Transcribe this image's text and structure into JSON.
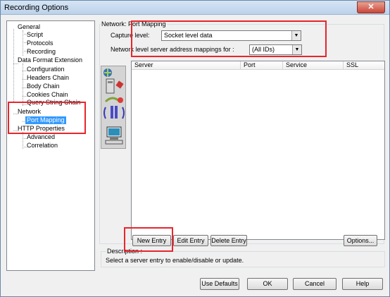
{
  "window": {
    "title": "Recording Options",
    "close_label": "✕"
  },
  "tree": {
    "items": [
      "General",
      "Script",
      "Protocols",
      "Recording",
      "Data Format Extension",
      "Configuration",
      "Headers Chain",
      "Body Chain",
      "Cookies Chain",
      "Query String Chain",
      "Network",
      "Port Mapping",
      "HTTP Properties",
      "Advanced",
      "Correlation"
    ],
    "selected": "Port Mapping"
  },
  "network": {
    "group_title": "Network: Port Mapping",
    "capture_level_label": "Capture level:",
    "capture_level_value": "Socket level data",
    "mappings_label": "Network level server address mappings for :",
    "mappings_value": "(All IDs)"
  },
  "table": {
    "columns": [
      "Server",
      "Port",
      "Service",
      "SSL"
    ],
    "rows": []
  },
  "actions": {
    "new_entry": "New Entry",
    "edit_entry": "Edit Entry",
    "delete_entry": "Delete Entry",
    "options": "Options..."
  },
  "description": {
    "title": "Description :",
    "text": "Select a server entry to enable/disable or update."
  },
  "footer": {
    "use_defaults": "Use Defaults",
    "ok": "OK",
    "cancel": "Cancel",
    "help": "Help"
  },
  "colors": {
    "highlight": "#e8252d",
    "selection": "#3399ff"
  }
}
